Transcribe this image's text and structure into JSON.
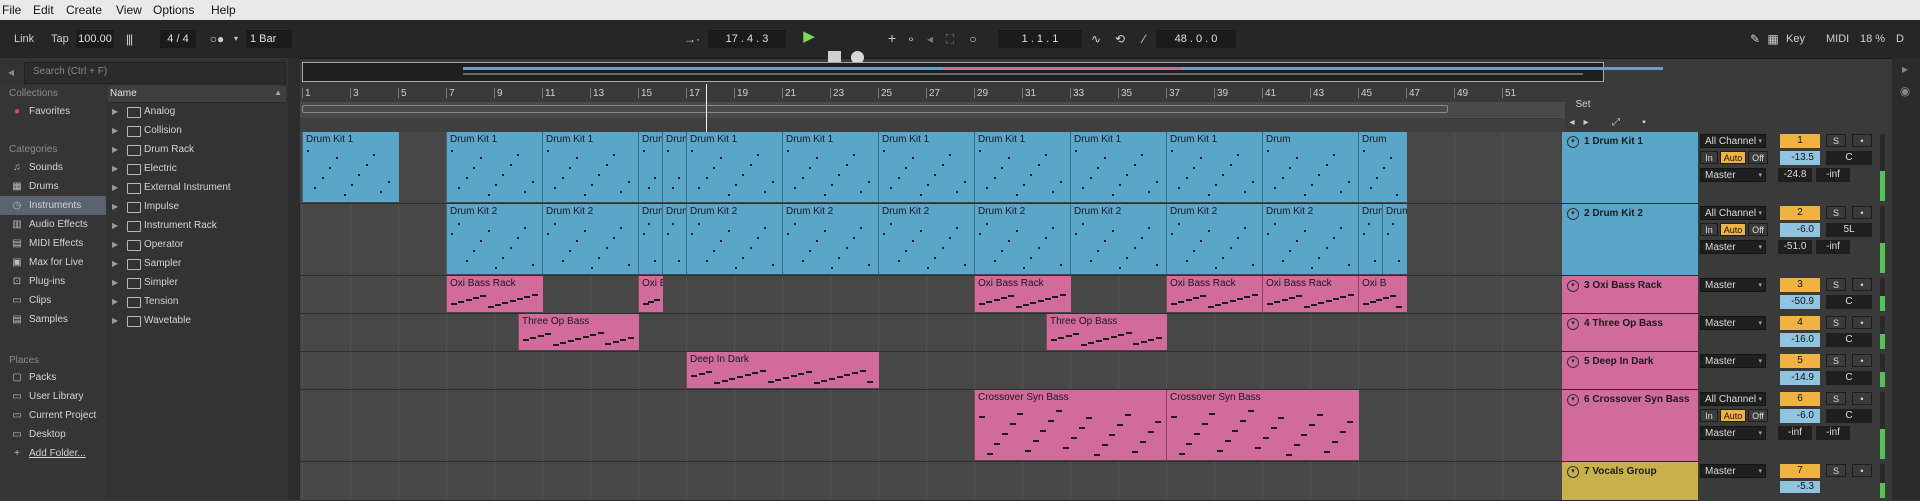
{
  "menu": [
    "File",
    "Edit",
    "Create",
    "View",
    "Options",
    "Help"
  ],
  "transport": {
    "link": "Link",
    "tap": "Tap",
    "tempo": "100.00",
    "time_sig": "4 / 4",
    "quantize": "1 Bar",
    "arrangement_position": "17 . 4 . 3",
    "loop_start": "1 . 1 . 1",
    "loop_length": "48 . 0 . 0",
    "key": "Key",
    "midi": "MIDI",
    "cpu": "18 %",
    "d": "D"
  },
  "browser": {
    "search_placeholder": "Search (Ctrl + F)",
    "collections_header": "Collections",
    "favorites": "Favorites",
    "categories_header": "Categories",
    "categories": [
      "Sounds",
      "Drums",
      "Instruments",
      "Audio Effects",
      "MIDI Effects",
      "Max for Live",
      "Plug-ins",
      "Clips",
      "Samples"
    ],
    "places_header": "Places",
    "places": [
      "Packs",
      "User Library",
      "Current Project",
      "Desktop",
      "Add Folder..."
    ],
    "column_header": "Name",
    "items": [
      "Analog",
      "Collision",
      "Drum Rack",
      "Electric",
      "External Instrument",
      "Impulse",
      "Instrument Rack",
      "Operator",
      "Sampler",
      "Simpler",
      "Tension",
      "Wavetable"
    ]
  },
  "ruler": [
    "1",
    "3",
    "5",
    "7",
    "9",
    "11",
    "13",
    "15",
    "17",
    "19",
    "21",
    "23",
    "25",
    "27",
    "29",
    "31",
    "33",
    "35",
    "37",
    "39",
    "41",
    "43",
    "45",
    "47",
    "49",
    "51"
  ],
  "set_label": "Set",
  "tracks": [
    {
      "num": "1",
      "name": "1 Drum Kit 1",
      "io": "All Channel",
      "out": "Master",
      "vol": "-13.5",
      "vol2": "-24.8",
      "vol3": "-inf",
      "pan": "C",
      "color": "#5aa6c9",
      "clips": [
        {
          "name": "Drum Kit 1"
        },
        {
          "name": "Drum Kit 1"
        },
        {
          "name": "Drum Kit 1"
        },
        {
          "name": "Drum Kit 1"
        },
        {
          "name": "Drum Kit 1"
        },
        {
          "name": "Drum Kit 1"
        },
        {
          "name": "Drum Kit 1"
        },
        {
          "name": "Drum Kit 1"
        },
        {
          "name": "Drum Kit 1"
        },
        {
          "name": "Drum Kit 1"
        },
        {
          "name": "Drum Kit 1"
        },
        {
          "name": "Drum"
        },
        {
          "name": "Drum"
        }
      ]
    },
    {
      "num": "2",
      "name": "2 Drum Kit 2",
      "io": "All Channel",
      "out": "Master",
      "vol": "-6.0",
      "vol2": "-51.0",
      "vol3": "-inf",
      "pan": "5L",
      "color": "#5aa6c9",
      "clips": [
        {
          "name": "Drum Kit 2"
        },
        {
          "name": "Drum Kit 2"
        },
        {
          "name": "Drum Kit 2"
        },
        {
          "name": "Drum Kit 2"
        },
        {
          "name": "Drum Kit 2"
        },
        {
          "name": "Drum Kit 2"
        },
        {
          "name": "Drum Kit 2"
        },
        {
          "name": "Drum Kit 2"
        },
        {
          "name": "Drum Kit 2"
        },
        {
          "name": "Drum Kit 2"
        },
        {
          "name": "Drum Kit 2"
        },
        {
          "name": "Drum"
        },
        {
          "name": "Drum"
        }
      ]
    },
    {
      "num": "3",
      "name": "3 Oxi Bass Rack",
      "out": "Master",
      "vol": "-50.9",
      "pan": "C",
      "color": "#d06b9b",
      "clips": [
        {
          "name": "Oxi Bass Rack"
        },
        {
          "name": "Oxi B"
        },
        {
          "name": "Oxi Bass Rack"
        },
        {
          "name": "Oxi Bass Rack"
        },
        {
          "name": "Oxi Bass Rack"
        },
        {
          "name": "Oxi B"
        }
      ]
    },
    {
      "num": "4",
      "name": "4 Three Op Bass",
      "out": "Master",
      "vol": "-16.0",
      "pan": "C",
      "color": "#d06b9b",
      "clips": [
        {
          "name": "Three Op Bass"
        },
        {
          "name": "Three Op Bass"
        }
      ]
    },
    {
      "num": "5",
      "name": "5 Deep In Dark",
      "out": "Master",
      "vol": "-14.9",
      "pan": "C",
      "color": "#d06b9b",
      "clips": [
        {
          "name": "Deep In Dark"
        }
      ]
    },
    {
      "num": "6",
      "name": "6 Crossover Syn Bass",
      "io": "All Channel",
      "out": "Master",
      "vol": "-6.0",
      "vol2": "-inf",
      "vol3": "-inf",
      "pan": "C",
      "color": "#d06b9b",
      "clips": [
        {
          "name": "Crossover Syn Bass"
        },
        {
          "name": "Crossover Syn Bass"
        }
      ]
    },
    {
      "num": "7",
      "name": "7 Vocals Group",
      "out": "Master",
      "vol": "-5.3",
      "color": "#c8b04a"
    }
  ],
  "btn": {
    "in": "In",
    "auto": "Auto",
    "off": "Off",
    "solo": "S",
    "arm": "•"
  }
}
